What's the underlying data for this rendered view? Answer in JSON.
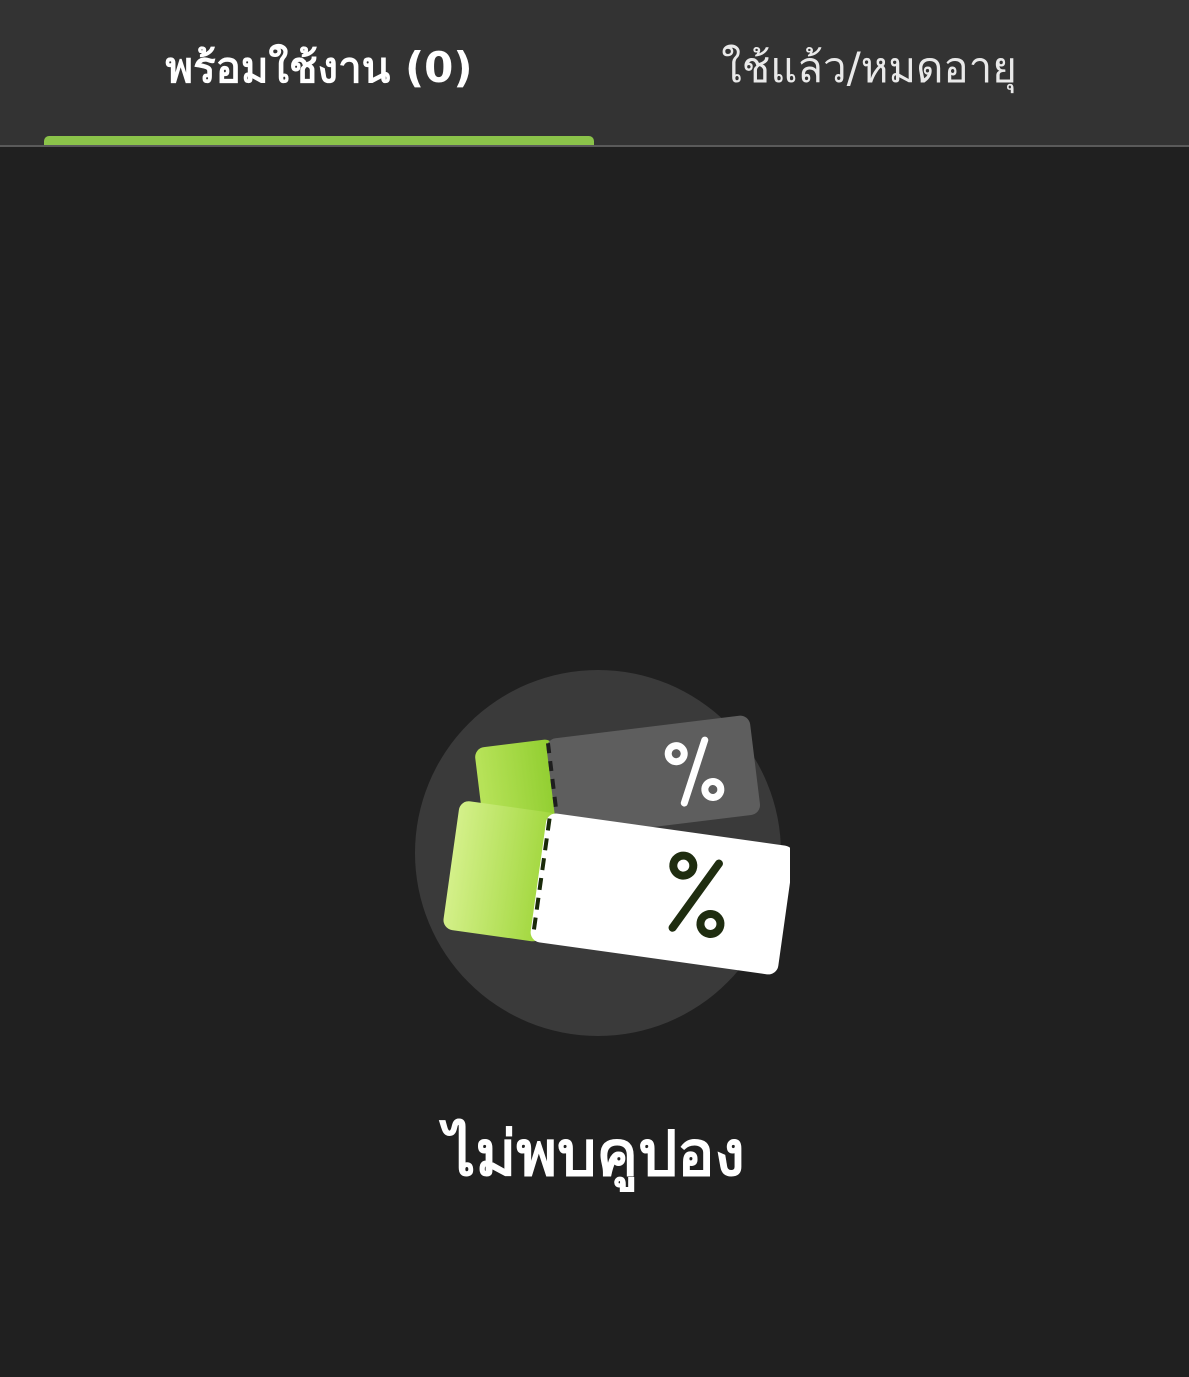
{
  "tabs": [
    {
      "label": "พร้อมใช้งาน (0)",
      "active": true
    },
    {
      "label": "ใช้แล้ว/หมดอายุ",
      "active": false
    }
  ],
  "empty_state": {
    "message": "ไม่พบคูปอง",
    "icon": "coupon-ticket-icon"
  },
  "colors": {
    "background": "#202020",
    "tab_bar": "#333333",
    "accent": "#8bc34a",
    "text": "#ffffff"
  }
}
